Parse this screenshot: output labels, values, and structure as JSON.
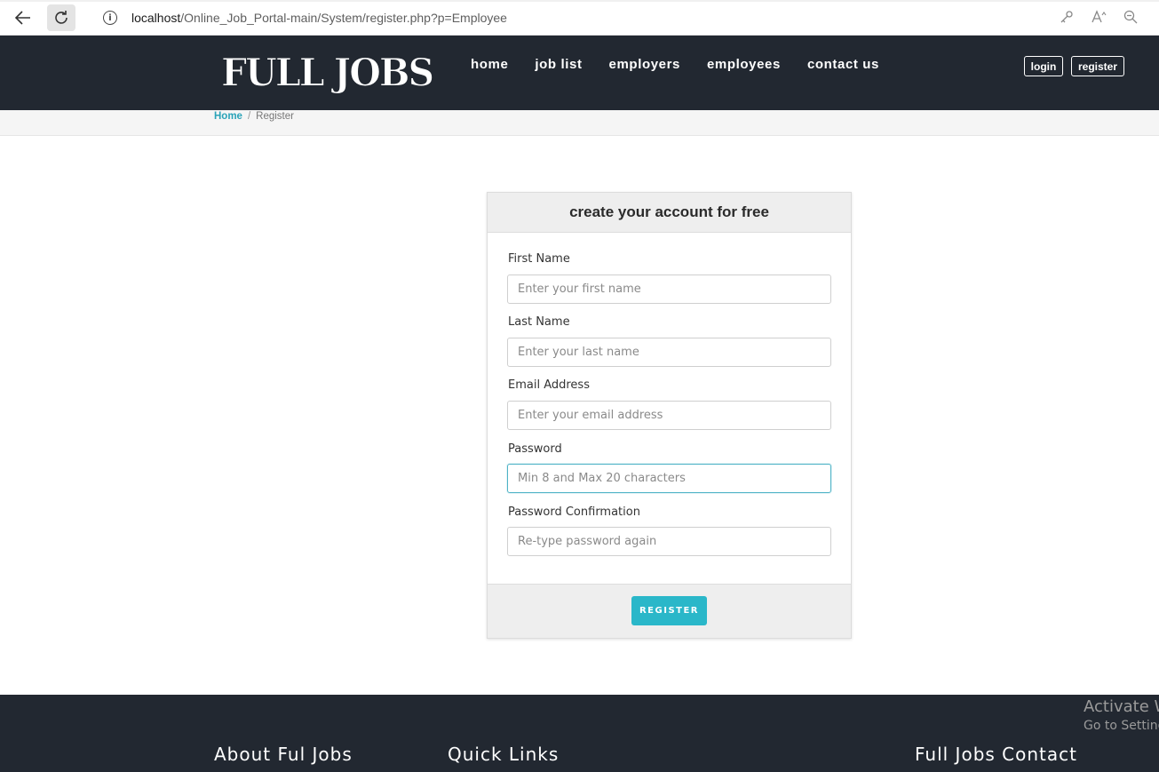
{
  "browser": {
    "url_host": "localhost",
    "url_path": "/Online_Job_Portal-main/System/register.php?p=Employee"
  },
  "header": {
    "logo": "FULL JOBS",
    "nav": [
      "home",
      "job list",
      "employers",
      "employees",
      "contact us"
    ],
    "login_label": "login",
    "register_label": "register"
  },
  "breadcrumb": {
    "home": "Home",
    "separator": "/",
    "current": "Register"
  },
  "form": {
    "title": "create your account for free",
    "fields": [
      {
        "label": "First Name",
        "placeholder": "Enter your first name",
        "value": ""
      },
      {
        "label": "Last Name",
        "placeholder": "Enter your last name",
        "value": ""
      },
      {
        "label": "Email Address",
        "placeholder": "Enter your email address",
        "value": ""
      },
      {
        "label": "Password",
        "placeholder": "Min 8 and Max 20 characters",
        "value": ""
      },
      {
        "label": "Password Confirmation",
        "placeholder": "Re-type password again",
        "value": ""
      }
    ],
    "submit_label": "REGISTER"
  },
  "footer": {
    "about_title": "About Ful Jobs",
    "links_title": "Quick Links",
    "contact_title": "Full Jobs Contact"
  },
  "watermark": {
    "line1": "Activate W",
    "line2": "Go to Setting"
  },
  "colors": {
    "header_bg": "#222831",
    "accent": "#2ab7c9",
    "link": "#2aa3b8"
  },
  "icons": {
    "back": "back-arrow-icon",
    "reload": "reload-icon",
    "info": "info-icon",
    "key": "key-icon",
    "read_aloud": "read-aloud-icon",
    "zoom": "zoom-out-icon"
  }
}
